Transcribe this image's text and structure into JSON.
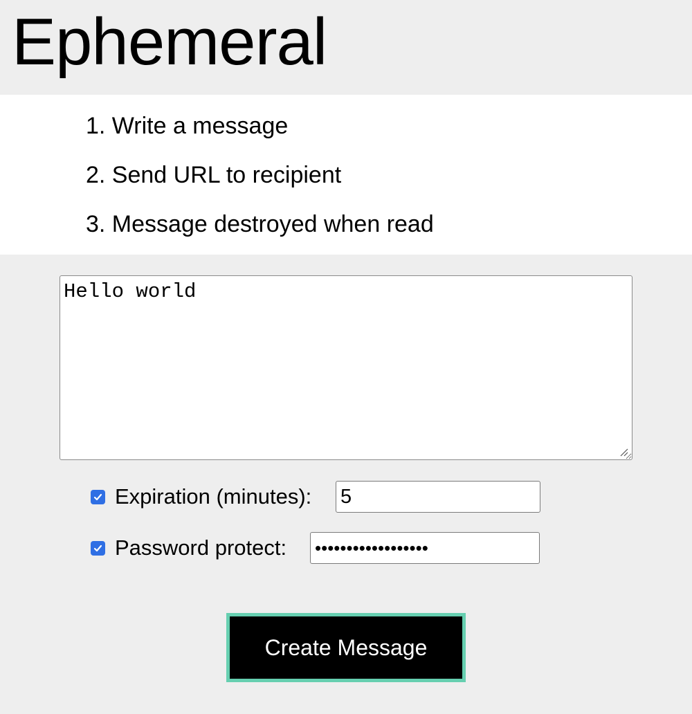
{
  "header": {
    "title": "Ephemeral"
  },
  "steps": [
    "1. Write a message",
    "2. Send URL to recipient",
    "3. Message destroyed when read"
  ],
  "form": {
    "message_value": "Hello world",
    "expiration": {
      "checked": true,
      "label": "Expiration (minutes):",
      "value": "5"
    },
    "password": {
      "checked": true,
      "label": "Password protect:",
      "masked_value": "••••••••••••••••••"
    },
    "submit_label": "Create Message"
  },
  "colors": {
    "page_bg": "#eeeeee",
    "steps_bg": "#ffffff",
    "checkbox": "#2f6fe4",
    "button_bg": "#000000",
    "button_border": "#66cfb0"
  }
}
